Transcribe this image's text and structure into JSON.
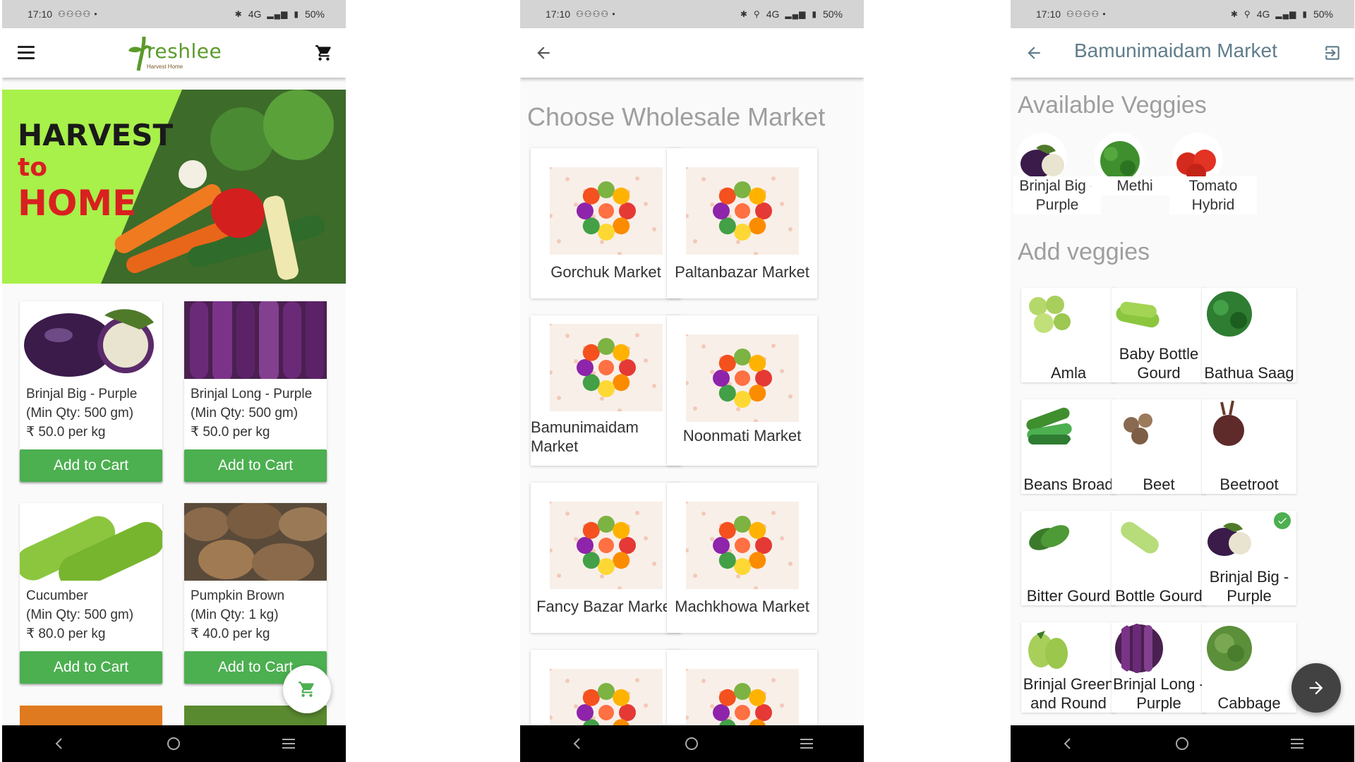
{
  "status": {
    "time": "17:10",
    "network": "4G",
    "battery": "50%"
  },
  "screen1": {
    "logo_text": "reshlee",
    "logo_tagline": "Harvest Home",
    "banner": {
      "line1": "HARVEST",
      "line2": "to",
      "line3": "HOME"
    },
    "add_label": "Add to Cart",
    "products": [
      {
        "name": "Brinjal Big - Purple",
        "min_qty": "(Min Qty: 500 gm)",
        "price": "₹ 50.0 per kg"
      },
      {
        "name": "Brinjal Long - Purple",
        "min_qty": "(Min Qty: 500 gm)",
        "price": "₹ 50.0 per kg"
      },
      {
        "name": "Cucumber",
        "min_qty": "(Min Qty: 500 gm)",
        "price": "₹ 80.0 per kg"
      },
      {
        "name": "Pumpkin Brown",
        "min_qty": "(Min Qty: 1 kg)",
        "price": "₹ 40.0 per kg"
      }
    ]
  },
  "screen2": {
    "title": "Choose Wholesale Market",
    "markets": [
      "Gorchuk Market",
      "Paltanbazar Market",
      "Bamunimaidam Market",
      "Noonmati Market",
      "Fancy Bazar Market",
      "Machkhowa Market"
    ]
  },
  "screen3": {
    "title": "Bamunimaidam Market",
    "available_title": "Available Veggies",
    "add_title": "Add veggies",
    "available": [
      "Brinjal Big - Purple",
      "Methi",
      "Tomato Hybrid"
    ],
    "veggies": [
      "Amla",
      "Baby Bottle Gourd",
      "Bathua Saag",
      "Beans Broad",
      "Beet",
      "Beetroot",
      "Bitter Gourd",
      "Bottle Gourd",
      "Brinjal Big - Purple",
      "Brinjal Green and Round",
      "Brinjal Long - Purple",
      "Cabbage"
    ],
    "selected_veggie": "Brinjal Big - Purple"
  },
  "icons": {
    "menu": "hamburger-icon",
    "cart": "cart-icon",
    "back": "arrow-back-icon",
    "exit": "exit-icon",
    "next": "arrow-forward-icon",
    "check": "check-circle-icon"
  },
  "colors": {
    "accent_green": "#4caf50",
    "title_grey": "#9e9e9e",
    "market_title": "#607d8b",
    "banner_green": "#a8f04a",
    "banner_red": "#d92020"
  }
}
